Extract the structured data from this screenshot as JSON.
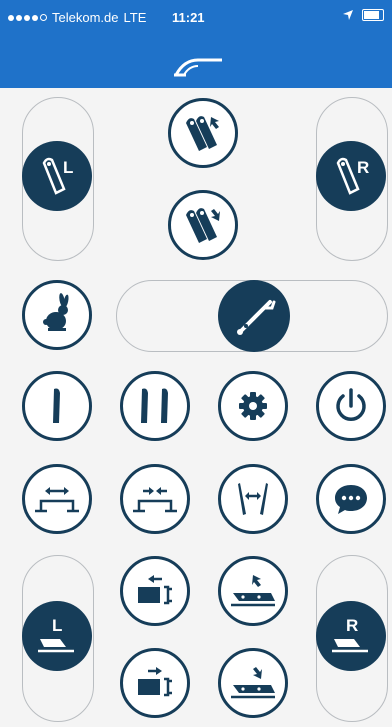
{
  "status": {
    "carrier": "Telekom.de",
    "network": "LTE",
    "time": "11:21"
  },
  "buttons": {
    "left_wing_label": "L",
    "right_wing_label": "R",
    "left_section_label": "L",
    "right_section_label": "R"
  },
  "icons": {
    "wings_up": "wings-up-icon",
    "wings_down": "wings-down-icon",
    "left_wing": "left-wing-icon",
    "right_wing": "right-wing-icon",
    "rabbit": "rabbit-icon",
    "boom_slider": "boom-arm-icon",
    "single_arm": "single-arm-icon",
    "double_arm": "double-arm-icon",
    "settings": "gear-icon",
    "power": "power-icon",
    "widen": "widen-icon",
    "narrow": "narrow-icon",
    "spread_arms": "spread-arms-icon",
    "chat": "chat-icon",
    "pump_out": "pump-out-icon",
    "pump_in": "pump-in-icon",
    "plough_up": "plough-up-icon",
    "plough_down": "plough-down-icon"
  },
  "colors": {
    "primary": "#1f72c9",
    "dark": "#163d59",
    "track": "#b9bdc1"
  }
}
